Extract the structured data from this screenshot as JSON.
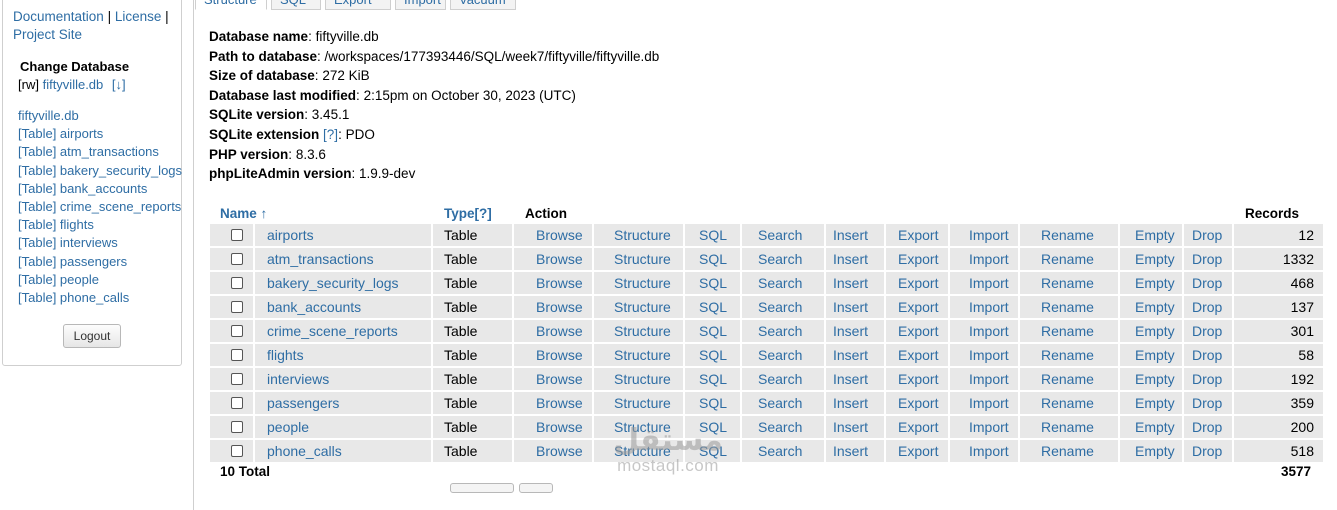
{
  "sidebar": {
    "top_links": [
      {
        "label": "Documentation"
      },
      {
        "label": "License"
      },
      {
        "label": "Project Site"
      }
    ],
    "top_separator": "|",
    "change_database_title": "Change Database",
    "rw_tag": "[rw]",
    "db_file": "fiftyville.db",
    "db_download": "[↓]",
    "db_link": "fiftyville.db",
    "tables": [
      "[Table] airports",
      "[Table] atm_transactions",
      "[Table] bakery_security_logs",
      "[Table] bank_accounts",
      "[Table] crime_scene_reports",
      "[Table] flights",
      "[Table] interviews",
      "[Table] passengers",
      "[Table] people",
      "[Table] phone_calls"
    ],
    "logout_label": "Logout"
  },
  "tabs": [
    {
      "label": "Structure",
      "active": true
    },
    {
      "label": "SQL",
      "active": false
    },
    {
      "label": "Export",
      "active": false
    },
    {
      "label": "Import",
      "active": false
    },
    {
      "label": "Vacuum",
      "active": false
    }
  ],
  "info": [
    {
      "label": "Database name",
      "sep": ": ",
      "value": "fiftyville.db"
    },
    {
      "label": "Path to database",
      "sep": ": ",
      "value": "/workspaces/177393446/SQL/week7/fiftyville/fiftyville.db"
    },
    {
      "label": "Size of database",
      "sep": ": ",
      "value": "272 KiB"
    },
    {
      "label": "Database last modified",
      "sep": ": ",
      "value": "2:15pm on October 30, 2023 (UTC)"
    },
    {
      "label": "SQLite version",
      "sep": ": ",
      "value": "3.45.1"
    },
    {
      "label": "SQLite extension",
      "sep": " ",
      "help": "[?]",
      "value": ": PDO"
    },
    {
      "label": "PHP version",
      "sep": ": ",
      "value": "8.3.6"
    },
    {
      "label": "phpLiteAdmin version",
      "sep": ": ",
      "value": "1.9.9-dev"
    }
  ],
  "table": {
    "headers": {
      "name": "Name ↑",
      "type": "Type[?]",
      "action": "Action",
      "records": "Records"
    },
    "actions": [
      "Browse",
      "Structure",
      "SQL",
      "Search",
      "Insert",
      "Export",
      "Import",
      "Rename",
      "Empty",
      "Drop"
    ],
    "rows": [
      {
        "name": "airports",
        "type": "Table",
        "records": "12"
      },
      {
        "name": "atm_transactions",
        "type": "Table",
        "records": "1332"
      },
      {
        "name": "bakery_security_logs",
        "type": "Table",
        "records": "468"
      },
      {
        "name": "bank_accounts",
        "type": "Table",
        "records": "137"
      },
      {
        "name": "crime_scene_reports",
        "type": "Table",
        "records": "301"
      },
      {
        "name": "flights",
        "type": "Table",
        "records": "58"
      },
      {
        "name": "interviews",
        "type": "Table",
        "records": "192"
      },
      {
        "name": "passengers",
        "type": "Table",
        "records": "359"
      },
      {
        "name": "people",
        "type": "Table",
        "records": "200"
      },
      {
        "name": "phone_calls",
        "type": "Table",
        "records": "518"
      }
    ],
    "total_label": "10 Total",
    "total_records": "3577"
  },
  "watermark": {
    "arabic": "مستقل",
    "latin": "mostaql.com"
  },
  "colors": {
    "link": "#2e6da4",
    "row_bg": "#e8e8e8",
    "border": "#cfcfcf"
  }
}
